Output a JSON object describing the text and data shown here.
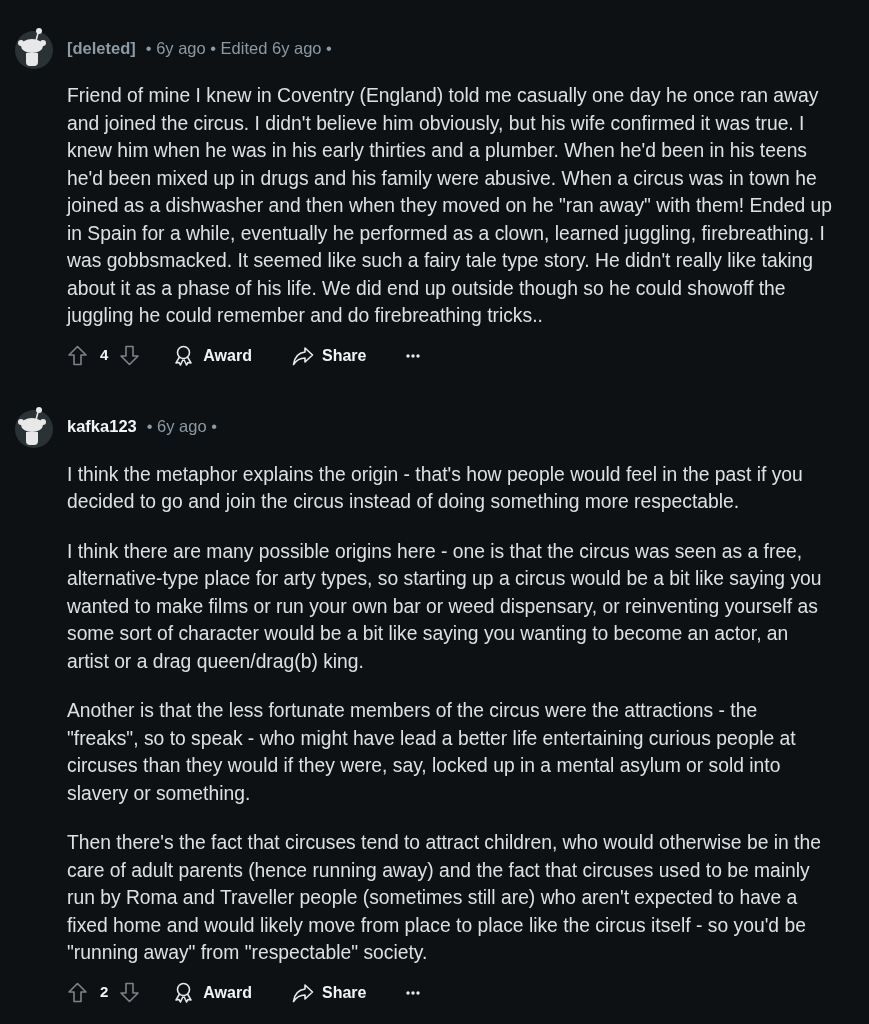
{
  "comments": [
    {
      "author": "[deleted]",
      "deleted": true,
      "meta": "• 6y ago • Edited 6y ago •",
      "paragraphs": [
        "Friend of mine I knew in Coventry (England) told me casually one day he once ran away and joined the circus. I didn't believe him obviously, but his wife confirmed it was true. I knew him when he was in his early thirties and a plumber. When he'd been in his teens he'd been mixed up in drugs and his family were abusive. When a circus was in town he joined as a dishwasher and then when they moved on he \"ran away\" with them! Ended up in Spain for a while, eventually he performed as a clown, learned juggling, firebreathing. I was gobbsmacked. It seemed like such a fairy tale type story. He didn't really like taking about it as a phase of his life. We did end up outside though so he could showoff the juggling he could remember and do firebreathing tricks.."
      ],
      "score": "4",
      "actions": [
        {
          "kind": "award",
          "label": "Award"
        },
        {
          "kind": "share",
          "label": "Share"
        }
      ]
    },
    {
      "author": "kafka123",
      "deleted": false,
      "meta": "• 6y ago •",
      "paragraphs": [
        "I think the metaphor explains the origin - that's how people would feel in the past if you decided to go and join the circus instead of doing something more respectable.",
        "I think there are many possible origins here - one is that the circus was seen as a free, alternative-type place for arty types, so starting up a circus would be a bit like saying you wanted to make films or run your own bar or weed dispensary, or reinventing yourself as some sort of character would be a bit like saying you wanting to become an actor, an artist or a drag queen/drag(b) king.",
        "Another is that the less fortunate members of the circus were the attractions - the \"freaks\", so to speak - who might have lead a better life entertaining curious people at circuses than they would if they were, say, locked up in a mental asylum or sold into slavery or something.",
        "Then there's the fact that circuses tend to attract children, who would otherwise be in the care of adult parents (hence running away) and the fact that circuses used to be mainly run by Roma and Traveller people (sometimes still are) who aren't expected to have a fixed home and would likely move from place to place like the circus itself - so you'd be \"running away\" from \"respectable\" society."
      ],
      "score": "2",
      "actions": [
        {
          "kind": "award",
          "label": "Award"
        },
        {
          "kind": "share",
          "label": "Share"
        }
      ]
    }
  ]
}
